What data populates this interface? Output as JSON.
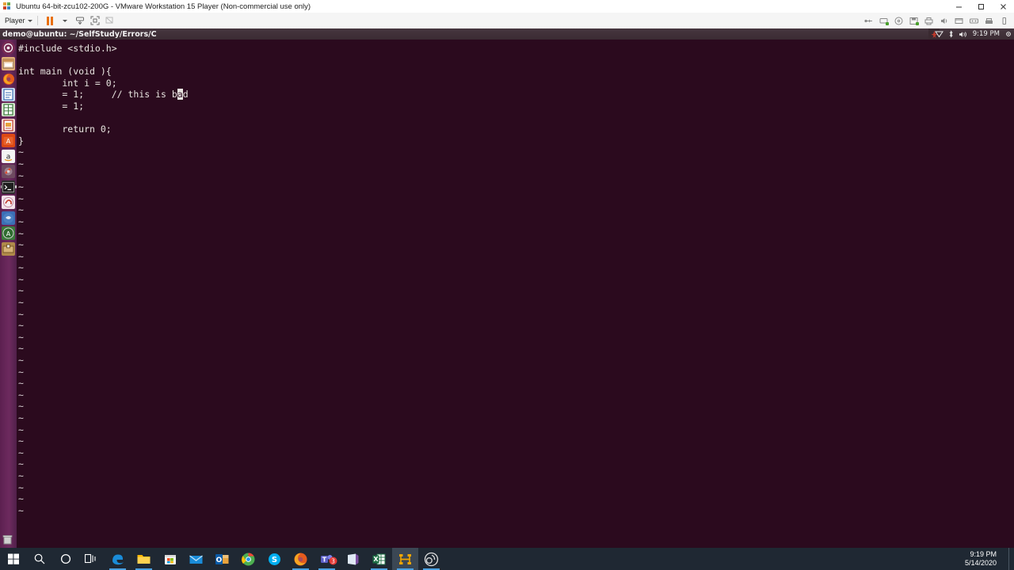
{
  "vmware": {
    "title": "Ubuntu 64-bit-zcu102-200G - VMware Workstation 15 Player (Non-commercial use only)",
    "title_icon": "vmware-logo-icon",
    "window_buttons": [
      {
        "name": "minimize-button",
        "glyph": "─"
      },
      {
        "name": "restore-button",
        "glyph": "❐"
      },
      {
        "name": "close-button",
        "glyph": "✕"
      }
    ],
    "toolbar": {
      "player_menu_label": "Player",
      "buttons": [
        {
          "name": "pause-button",
          "label": "Pause"
        },
        {
          "name": "pause-dropdown",
          "label": "Pause options"
        },
        {
          "name": "send-ctrl-alt-del-button",
          "label": "Send Ctrl+Alt+Del"
        },
        {
          "name": "fullscreen-button",
          "label": "Enter full screen"
        },
        {
          "name": "unity-mode-button",
          "label": "Unity mode"
        }
      ],
      "status_icons": [
        {
          "name": "usb-icon",
          "label": "USB devices"
        },
        {
          "name": "network-adapter-icon",
          "label": "Network adapter"
        },
        {
          "name": "cd-dvd-icon",
          "label": "CD/DVD drive"
        },
        {
          "name": "floppy-icon",
          "label": "Removable devices"
        },
        {
          "name": "printer-icon",
          "label": "Printer"
        },
        {
          "name": "sound-icon",
          "label": "Sound card"
        },
        {
          "name": "display-icon",
          "label": "Display"
        },
        {
          "name": "camera-icon",
          "label": "Camera"
        },
        {
          "name": "hard-disk-icon",
          "label": "Hard disk"
        },
        {
          "name": "battery-icon",
          "label": "Battery"
        }
      ]
    }
  },
  "ubuntu": {
    "panel": {
      "window_title": "demo@ubuntu: ~/SelfStudy/Errors/C",
      "app_badge": "system-notification-icon",
      "indicators": [
        {
          "name": "messaging-icon",
          "glyph": "♡"
        },
        {
          "name": "bluetooth-icon",
          "glyph": "ᛦ"
        },
        {
          "name": "volume-icon",
          "glyph": "ᴘ))"
        }
      ],
      "clock": "9:19 PM",
      "settings_icon": "gear-icon"
    },
    "launcher": {
      "items": [
        {
          "name": "launcher-dash-home",
          "label": "Dash home",
          "color": "#772953",
          "glyph": "◉",
          "running": false
        },
        {
          "name": "launcher-files",
          "label": "Files",
          "color": "#e8b178",
          "glyph": "▤",
          "running": false
        },
        {
          "name": "launcher-firefox",
          "label": "Firefox Web Browser",
          "color": "#e0672a",
          "glyph": "◕",
          "running": false
        },
        {
          "name": "launcher-libreoffice-writer",
          "label": "LibreOffice Writer",
          "color": "#dfe9f5",
          "glyph": "☰",
          "running": false
        },
        {
          "name": "launcher-libreoffice-calc",
          "label": "LibreOffice Calc",
          "color": "#e3f0dc",
          "glyph": "⊞",
          "running": false
        },
        {
          "name": "launcher-libreoffice-impress",
          "label": "LibreOffice Impress",
          "color": "#f7e0d8",
          "glyph": "▦",
          "running": false
        },
        {
          "name": "launcher-ubuntu-software",
          "label": "Ubuntu Software",
          "color": "#dd4814",
          "glyph": "A",
          "running": false
        },
        {
          "name": "launcher-amazon",
          "label": "Amazon",
          "color": "#f2f2f2",
          "glyph": "a",
          "running": false
        },
        {
          "name": "launcher-system-settings",
          "label": "System Settings",
          "color": "#6e4a60",
          "glyph": "⚙",
          "running": false
        },
        {
          "name": "launcher-terminal",
          "label": "Terminal",
          "color": "#2c2c2c",
          "glyph": "$_",
          "running": true
        },
        {
          "name": "launcher-help",
          "label": "Ubuntu Help",
          "color": "#f0e4ea",
          "glyph": "↻",
          "running": false
        },
        {
          "name": "launcher-remmina",
          "label": "Remmina Remote Desktop",
          "color": "#3b6fb5",
          "glyph": "➶",
          "running": false
        },
        {
          "name": "launcher-text-editor",
          "label": "Text Editor",
          "color": "#3b7a3b",
          "glyph": "A",
          "running": false
        },
        {
          "name": "launcher-archive-manager",
          "label": "Archive Manager",
          "color": "#b08a4a",
          "glyph": "⌗",
          "running": false
        }
      ],
      "trash": {
        "name": "launcher-trash",
        "label": "Trash",
        "glyph": "Ὕ1"
      }
    },
    "vim": {
      "lines": [
        "#include <stdio.h>",
        "",
        "int main (void ){",
        "        int i = 0;",
        "        = 1;     // this is bad",
        "        = 1;",
        "",
        "        return 0;",
        "}"
      ],
      "cursor": {
        "line": 4,
        "col": 30,
        "char": "a",
        "word": "bad"
      },
      "empty_line_marker": "~",
      "empty_line_count": 32
    }
  },
  "windows_taskbar": {
    "items": [
      {
        "name": "start-button",
        "label": "Start",
        "icon": "windows-logo-icon",
        "running": false,
        "active": false
      },
      {
        "name": "search-button",
        "label": "Search",
        "icon": "search-icon",
        "running": false,
        "active": false
      },
      {
        "name": "cortana-button",
        "label": "Cortana",
        "icon": "circle-icon",
        "running": false,
        "active": false
      },
      {
        "name": "task-view-button",
        "label": "Task View",
        "icon": "task-view-icon",
        "running": false,
        "active": false
      },
      {
        "name": "taskbar-edge",
        "label": "Microsoft Edge",
        "icon": "edge-icon",
        "running": true,
        "active": false
      },
      {
        "name": "taskbar-file-explorer",
        "label": "File Explorer",
        "icon": "folder-icon",
        "running": true,
        "active": false
      },
      {
        "name": "taskbar-microsoft-store",
        "label": "Microsoft Store",
        "icon": "store-icon",
        "running": false,
        "active": false
      },
      {
        "name": "taskbar-mail",
        "label": "Mail",
        "icon": "mail-icon",
        "running": false,
        "active": false
      },
      {
        "name": "taskbar-outlook",
        "label": "Outlook",
        "icon": "outlook-icon",
        "running": false,
        "active": false
      },
      {
        "name": "taskbar-chrome",
        "label": "Google Chrome",
        "icon": "chrome-icon",
        "running": false,
        "active": false
      },
      {
        "name": "taskbar-skype",
        "label": "Skype",
        "icon": "skype-icon",
        "running": false,
        "active": false
      },
      {
        "name": "taskbar-firefox",
        "label": "Mozilla Firefox",
        "icon": "firefox-icon",
        "running": true,
        "active": false
      },
      {
        "name": "taskbar-teams",
        "label": "Microsoft Teams",
        "icon": "teams-icon",
        "running": true,
        "active": false,
        "badge": "3"
      },
      {
        "name": "taskbar-onenote",
        "label": "OneNote",
        "icon": "onenote-icon",
        "running": false,
        "active": false
      },
      {
        "name": "taskbar-excel",
        "label": "Excel",
        "icon": "excel-icon",
        "running": true,
        "active": false
      },
      {
        "name": "taskbar-vmware",
        "label": "VMware Workstation 15 Player",
        "icon": "vmware-icon",
        "running": true,
        "active": true
      },
      {
        "name": "taskbar-obs",
        "label": "OBS Studio",
        "icon": "obs-icon",
        "running": true,
        "active": false
      }
    ],
    "clock": {
      "time": "9:19 PM",
      "date": "5/14/2020"
    },
    "show_desktop": {
      "name": "show-desktop-button",
      "label": "Show desktop"
    }
  },
  "colors": {
    "terminal_bg": "#2b0a1e",
    "launcher_bg": "#6d2a5e",
    "panel_bg": "#3b2b33",
    "taskbar_bg": "#1f2833",
    "accent_orange": "#e8700f",
    "terminal_text": "#e8e4e0"
  }
}
